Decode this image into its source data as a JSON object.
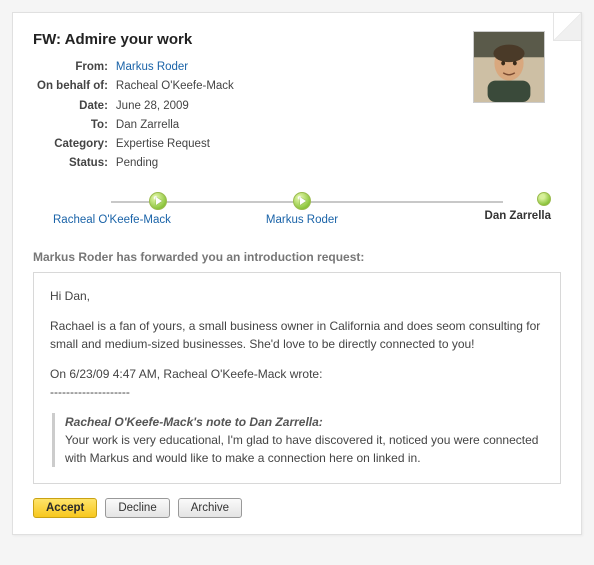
{
  "subject": "FW: Admire your work",
  "meta": {
    "labels": {
      "from": "From:",
      "on_behalf_of": "On behalf of:",
      "date": "Date:",
      "to": "To:",
      "category": "Category:",
      "status": "Status:"
    },
    "from": "Markus Roder",
    "on_behalf_of": "Racheal O'Keefe-Mack",
    "date": "June 28, 2009",
    "to": "Dan Zarrella",
    "category": "Expertise Request",
    "status": "Pending"
  },
  "chain": [
    {
      "label": "Racheal O'Keefe-Mack",
      "is_self": false,
      "has_arrow": true
    },
    {
      "label": "Markus Roder",
      "is_self": false,
      "has_arrow": true
    },
    {
      "label": "Dan Zarrella",
      "is_self": true,
      "has_arrow": false
    }
  ],
  "intro_heading": "Markus Roder has forwarded you an introduction request:",
  "message": {
    "greeting": "Hi Dan,",
    "body": "Rachael is a fan of yours, a small business owner in California and does seom consulting for small and medium-sized businesses. She'd love to be directly connected to you!",
    "quoted_header": "On 6/23/09 4:47 AM, Racheal O'Keefe-Mack wrote:",
    "separator": "--------------------",
    "quote_title": "Racheal O'Keefe-Mack's note to Dan Zarrella:",
    "quote_body": "Your work is very educational, I'm glad to have discovered it, noticed you were connected with Markus and would like to make a connection here on linked in."
  },
  "actions": {
    "accept": "Accept",
    "decline": "Decline",
    "archive": "Archive"
  }
}
